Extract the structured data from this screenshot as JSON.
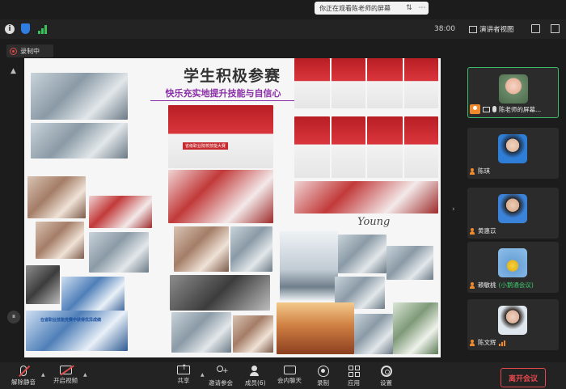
{
  "app": {
    "share_notice": "你正在观看陈老师的屏幕",
    "timer": "38:00",
    "view_label": "演讲者视图",
    "recording_label": "录制中"
  },
  "slide": {
    "title": "学生积极参赛",
    "subtitle": "快乐充实地提升技能与自信心",
    "script_text": "Young",
    "banner_text": "省级职业院校技能大赛",
    "caption_text": "在省职业技能竞赛中获得优异成绩"
  },
  "participants": [
    {
      "name": "陈老师的屏幕...",
      "avatar": "cartoon",
      "active": true,
      "host": true
    },
    {
      "name": "陈琪",
      "avatar": "person1"
    },
    {
      "name": "黄惠苡",
      "avatar": "person2"
    },
    {
      "name": "赖敏桃",
      "tag": "(小鹅通会议)",
      "avatar": "flower"
    },
    {
      "name": "陈文辉",
      "avatar": "person3"
    }
  ],
  "toolbar": {
    "unmute": "解除静音",
    "start_video": "开启视频",
    "share": "共享",
    "invite": "邀请参会",
    "members": "成员(6)",
    "chat": "会内聊天",
    "record": "录制",
    "apps": "应用",
    "settings": "设置",
    "leave": "离开会议"
  },
  "colors": {
    "accent_green": "#3dba6b",
    "leave_red": "#e5484d",
    "subtitle_purple": "#8b2fa8",
    "user_orange": "#f08a2c"
  }
}
